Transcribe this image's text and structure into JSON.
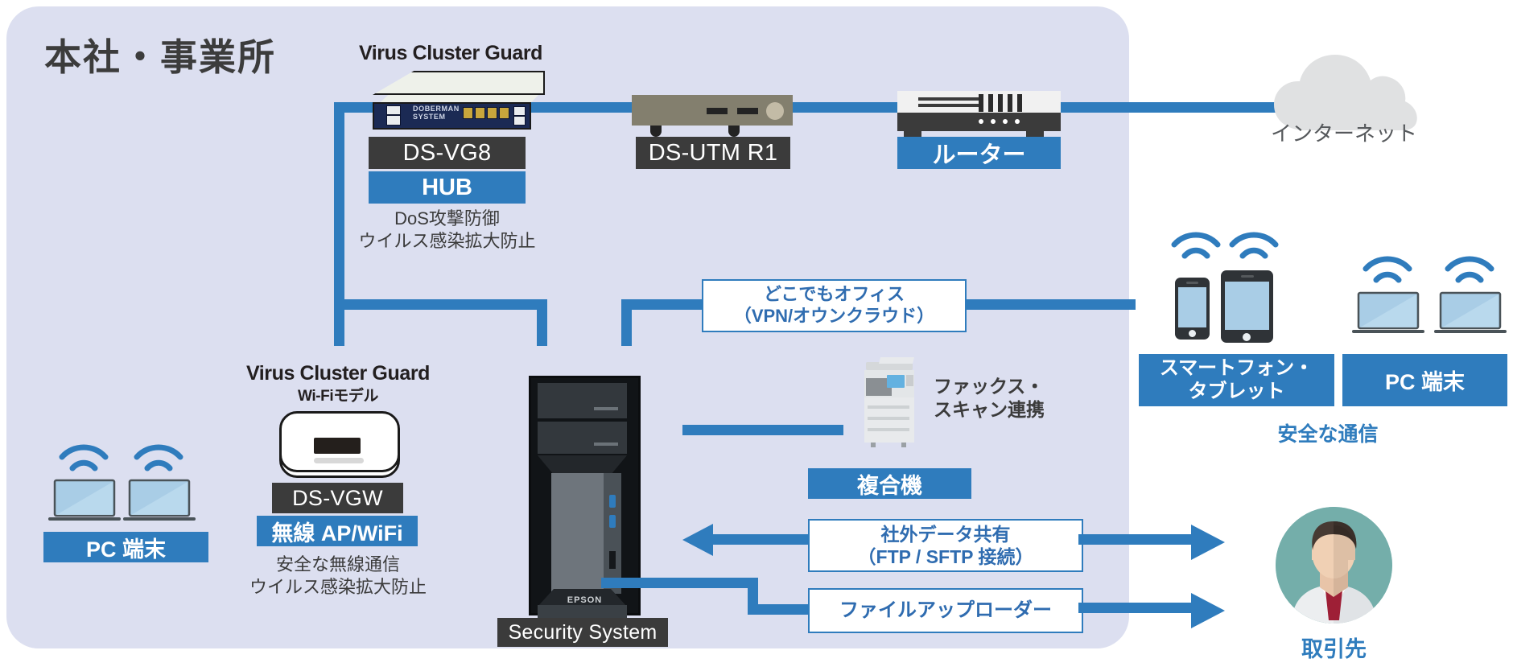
{
  "diagram": {
    "section_title": "本社・事業所",
    "colors": {
      "panel_bg": "#dcdff0",
      "accent_blue": "#2f7cbd",
      "label_dark": "#3b3b3b",
      "text_dark": "#3c3c3c",
      "callout_text": "#2f6cb0",
      "avatar_bg": "#74aeaa"
    }
  },
  "nodes": {
    "vg8": {
      "product_name": "Virus Cluster Guard",
      "model_label": "DS-VG8",
      "role_label": "HUB",
      "brand_line1": "DOBERMAN",
      "brand_line2": "SYSTEM",
      "note_line1": "DoS攻撃防御",
      "note_line2": "ウイルス感染拡大防止"
    },
    "utm": {
      "label": "DS-UTM R1"
    },
    "router": {
      "label": "ルーター"
    },
    "internet": {
      "label": "インターネット"
    },
    "vgw": {
      "product_name": "Virus Cluster Guard",
      "product_sub": "Wi-Fiモデル",
      "model_label": "DS-VGW",
      "role_label": "無線 AP/WiFi",
      "note_line1": "安全な無線通信",
      "note_line2": "ウイルス感染拡大防止"
    },
    "pc_left": {
      "label": "PC 端末"
    },
    "server": {
      "label": "Security System",
      "brand": "EPSON"
    },
    "mfp": {
      "label": "複合機",
      "note_line1": "ファックス・",
      "note_line2": "スキャン連携"
    },
    "smartphone_tablet": {
      "label": "スマートフォン・\nタブレット",
      "line1": "スマートフォン・",
      "line2": "タブレット"
    },
    "pc_right": {
      "label": "PC 端末"
    },
    "secure_comm": {
      "label": "安全な通信"
    },
    "partner": {
      "label": "取引先"
    }
  },
  "callouts": {
    "vpn": {
      "line1": "どこでもオフィス",
      "line2": "（VPN/オウンクラウド）"
    },
    "ftp": {
      "line1": "社外データ共有",
      "line2": "（FTP / SFTP 接続）"
    },
    "uploader": {
      "line1": "ファイルアップローダー"
    }
  }
}
